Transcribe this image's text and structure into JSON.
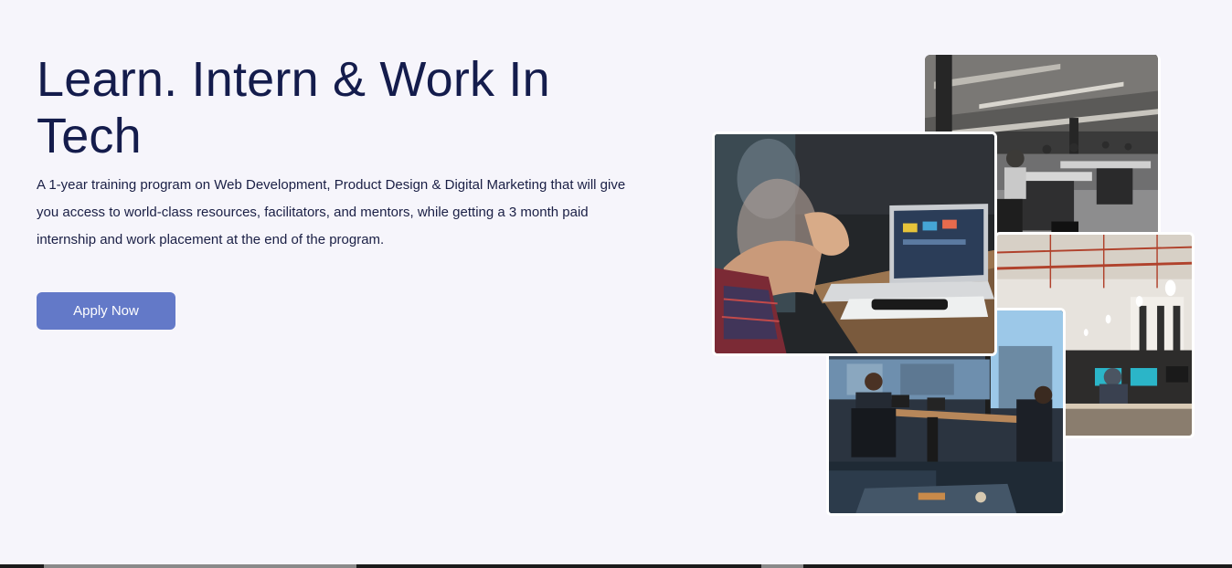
{
  "hero": {
    "title": "Learn. Intern & Work In Tech",
    "description": "A 1-year training program on Web Development, Product Design & Digital Marketing that will give you access to world-class resources, facilitators, and mentors, while getting a 3 month paid internship and work placement at the end of the program.",
    "cta_label": "Apply Now"
  },
  "colors": {
    "background": "#f6f5fb",
    "title": "#141c4c",
    "button": "#6379c8",
    "button_text": "#ffffff"
  },
  "images": [
    {
      "name": "open-office-photo"
    },
    {
      "name": "loft-office-photo"
    },
    {
      "name": "window-office-photo"
    },
    {
      "name": "laptop-meeting-photo"
    }
  ]
}
